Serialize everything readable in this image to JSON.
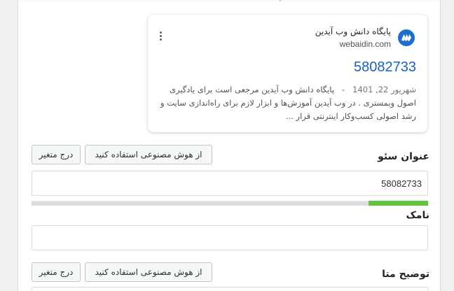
{
  "preview": {
    "site_name": "پایگاه دانش وب آیدین",
    "site_url": "webaidin.com",
    "logo_icon": "webaidin-logo-icon",
    "menu_icon": "kebab-menu-icon",
    "title": "58082733",
    "date": "شهریور 22, 1401",
    "separator": "-",
    "description": "پایگاه دانش وب آیدین مرجعی است برای یادگیری اصول وبمستری . در وب آیدین آموزش‌ها و ابزار لازم برای راه‌اندازی سایت و رشد اصولی کسب‌وکار اینترنتی قرار ..."
  },
  "seo_title": {
    "label": "عنوان سئو",
    "ai_button": "از هوش مصنوعی استفاده کنید",
    "insert_variable_button": "درج متغیر",
    "value": "58082733",
    "length_progress": 0.15,
    "progress_color": "#5fc33f"
  },
  "slug": {
    "label": "نامک",
    "value": ""
  },
  "meta_description": {
    "label": "توضیح متا",
    "ai_button": "از هوش مصنوعی استفاده کنید",
    "insert_variable_button": "درج متغیر"
  }
}
